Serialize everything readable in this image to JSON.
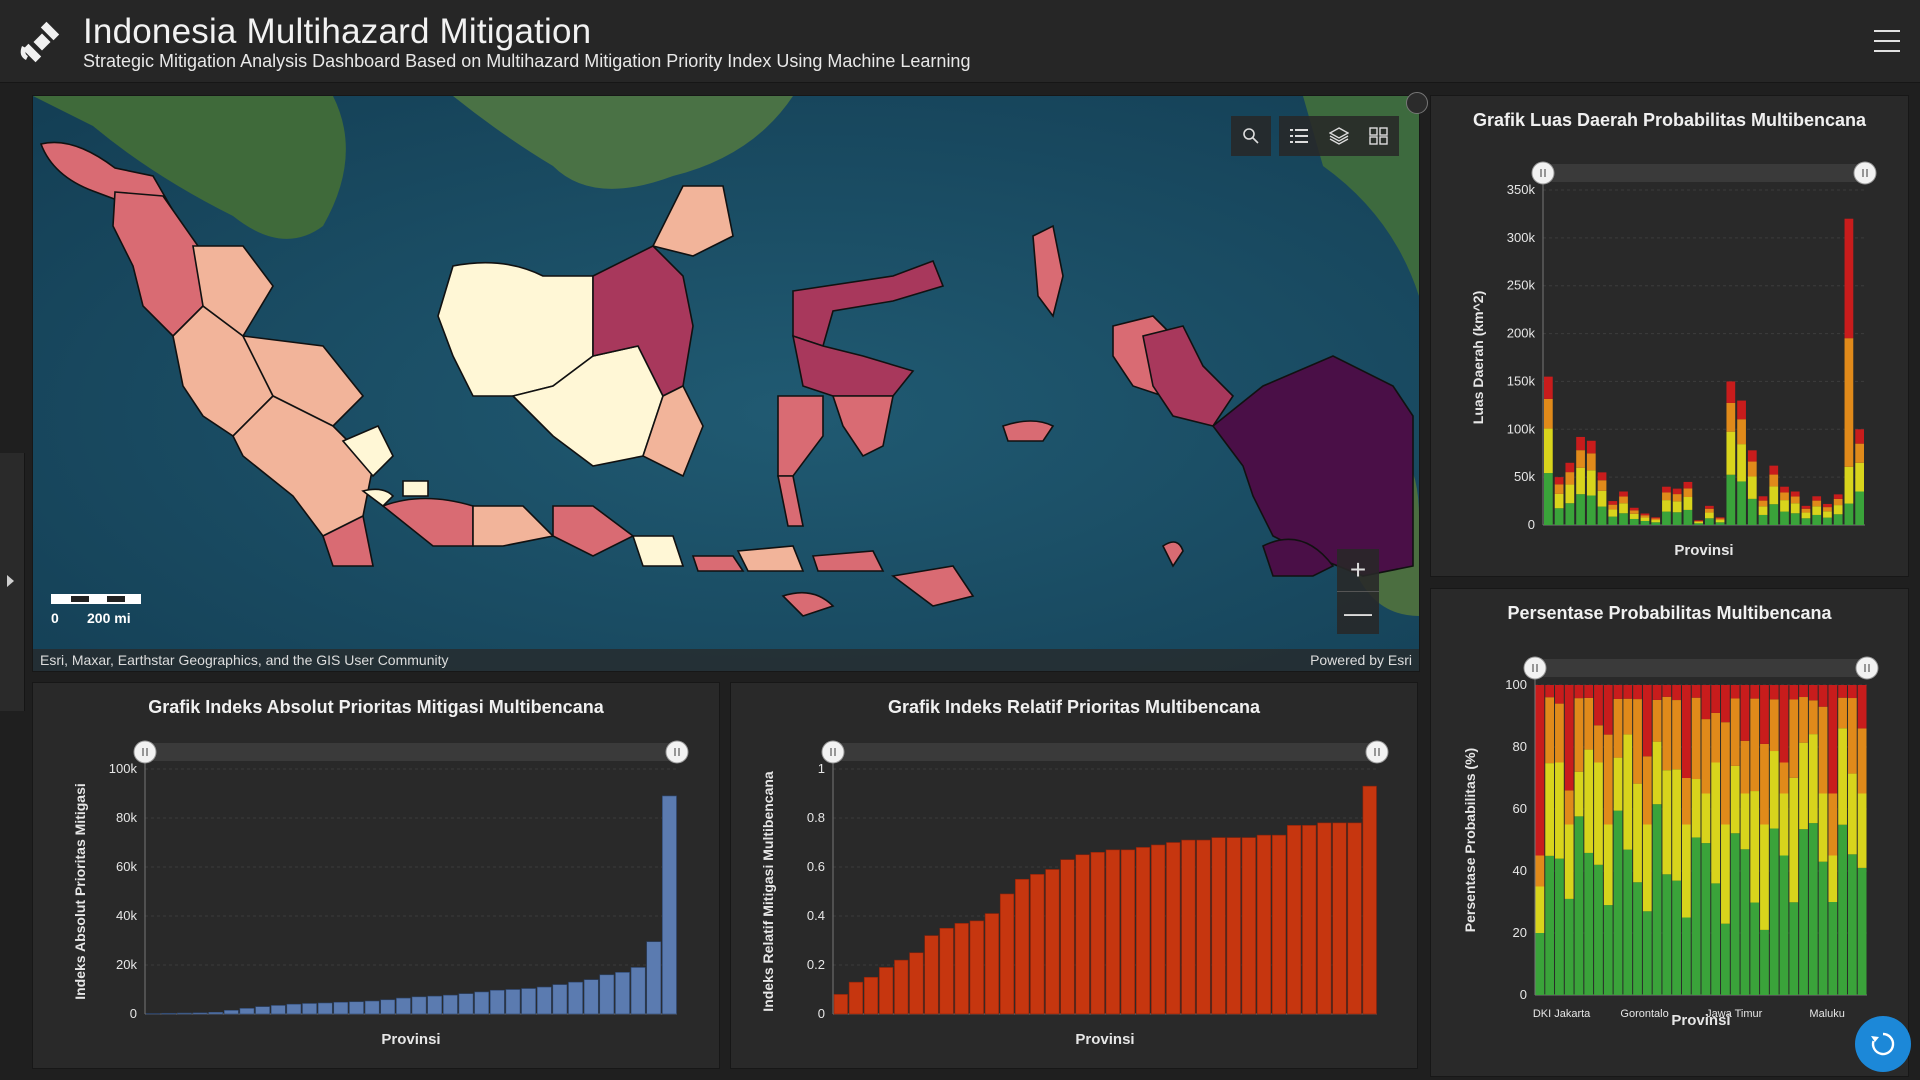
{
  "header": {
    "title": "Indonesia Multihazard Mitigation",
    "subtitle": "Strategic Mitigation Analysis Dashboard Based on Multihazard Mitigation Priority Index Using Machine Learning"
  },
  "map": {
    "scale_zero": "0",
    "scale_label": "200 mi",
    "attribution": "Esri, Maxar, Earthstar Geographics, and the GIS User Community",
    "powered_by": "Powered by Esri",
    "zoom_in": "+",
    "zoom_out": "—",
    "tools": [
      "search-icon",
      "legend-icon",
      "layers-icon",
      "basemap-gallery-icon"
    ],
    "choropleth_colors": [
      "#fff7d6",
      "#f2b49a",
      "#d96b73",
      "#a8385c",
      "#4a0f47"
    ]
  },
  "charts": {
    "luas": {
      "title": "Grafik Luas Daerah Probabilitas Multibencana",
      "ylabel": "Luas Daerah (km^2)",
      "xlabel": "Provinsi",
      "yticks": [
        "0",
        "50k",
        "100k",
        "150k",
        "200k",
        "250k",
        "300k",
        "350k"
      ]
    },
    "persen": {
      "title": "Persentase Probabilitas Multibencana",
      "ylabel": "Persentase Probabilitas (%)",
      "xlabel": "Provinsi",
      "yticks": [
        "0",
        "20",
        "40",
        "60",
        "80",
        "100"
      ],
      "xticks": [
        "DKI Jakarta",
        "Gorontalo",
        "Jawa Timur",
        "Maluku"
      ]
    },
    "absolut": {
      "title": "Grafik Indeks Absolut Prioritas Mitigasi Multibencana",
      "ylabel": "Indeks Absolut Prioritas Mitigasi",
      "xlabel": "Provinsi",
      "yticks": [
        "0",
        "20k",
        "40k",
        "60k",
        "80k",
        "100k"
      ]
    },
    "relatif": {
      "title": "Grafik Indeks Relatif Prioritas Multibencana",
      "ylabel": "Indeks Relatif Mitigasi Multibencana",
      "xlabel": "Provinsi",
      "yticks": [
        "0",
        "0.2",
        "0.4",
        "0.6",
        "0.8",
        "1"
      ]
    }
  },
  "chart_data": [
    {
      "type": "bar",
      "stacked": true,
      "title": "Grafik Luas Daerah Probabilitas Multibencana",
      "xlabel": "Provinsi",
      "ylabel": "Luas Daerah (km^2)",
      "ylim": [
        0,
        350000
      ],
      "series_colors": [
        "#3aa33a",
        "#d8d41c",
        "#e08a1a",
        "#c81c1c"
      ],
      "totals": [
        155000,
        50000,
        65000,
        92000,
        88000,
        55000,
        25000,
        35000,
        18000,
        12000,
        8000,
        40000,
        38000,
        45000,
        5000,
        20000,
        8000,
        150000,
        130000,
        78000,
        30000,
        62000,
        40000,
        35000,
        20000,
        30000,
        22000,
        32000,
        320000,
        100000
      ]
    },
    {
      "type": "bar",
      "stacked": true,
      "title": "Persentase Probabilitas Multibencana",
      "xlabel": "Provinsi",
      "ylabel": "Persentase Probabilitas (%)",
      "ylim": [
        0,
        100
      ],
      "tick_labels": [
        "DKI Jakarta",
        "Gorontalo",
        "Jawa Timur",
        "Maluku"
      ]
    },
    {
      "type": "bar",
      "title": "Grafik Indeks Absolut Prioritas Mitigasi Multibencana",
      "xlabel": "Provinsi",
      "ylabel": "Indeks Absolut Prioritas Mitigasi",
      "ylim": [
        0,
        100000
      ],
      "color": "#5b7bb0",
      "values": [
        200,
        300,
        400,
        500,
        700,
        1500,
        2300,
        3000,
        3500,
        4000,
        4300,
        4500,
        4800,
        5000,
        5300,
        5800,
        6500,
        7000,
        7300,
        7700,
        8300,
        9000,
        9700,
        10000,
        10400,
        11000,
        12000,
        13000,
        14000,
        16000,
        17000,
        19000,
        29500,
        89000
      ]
    },
    {
      "type": "bar",
      "title": "Grafik Indeks Relatif Prioritas Multibencana",
      "xlabel": "Provinsi",
      "ylabel": "Indeks Relatif Mitigasi Multibencana",
      "ylim": [
        0,
        1
      ],
      "color": "#c6360f",
      "values": [
        0.08,
        0.13,
        0.15,
        0.19,
        0.22,
        0.25,
        0.32,
        0.35,
        0.37,
        0.38,
        0.41,
        0.49,
        0.55,
        0.57,
        0.59,
        0.63,
        0.65,
        0.66,
        0.67,
        0.67,
        0.68,
        0.69,
        0.7,
        0.71,
        0.71,
        0.72,
        0.72,
        0.72,
        0.73,
        0.73,
        0.77,
        0.77,
        0.78,
        0.78,
        0.78,
        0.93
      ]
    }
  ]
}
